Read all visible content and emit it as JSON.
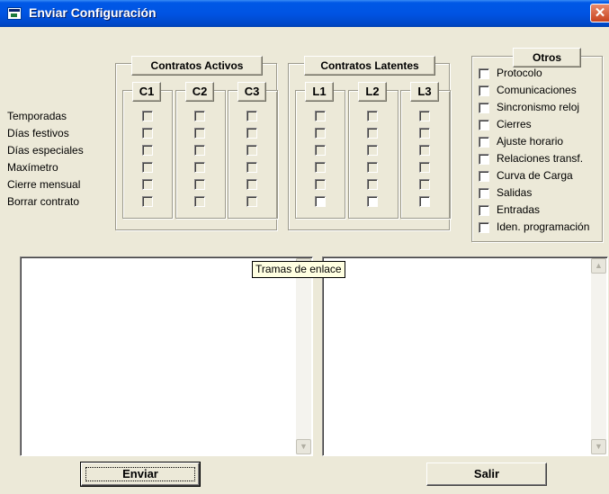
{
  "window": {
    "title": "Enviar Configuración",
    "close_glyph": "✕",
    "icon": "app-window-icon"
  },
  "activos": {
    "title": "Contratos Activos",
    "columns": [
      "C1",
      "C2",
      "C3"
    ]
  },
  "latentes": {
    "title": "Contratos Latentes",
    "columns": [
      "L1",
      "L2",
      "L3"
    ]
  },
  "rows": [
    "Temporadas",
    "Días festivos",
    "Días especiales",
    "Maxímetro",
    "Cierre mensual",
    "Borrar contrato"
  ],
  "otros": {
    "title": "Otros",
    "items": [
      "Protocolo",
      "Comunicaciones",
      "Sincronismo reloj",
      "Cierres",
      "Ajuste horario",
      "Relaciones transf.",
      "Curva de Carga",
      "Salidas",
      "Entradas",
      "Iden. programación"
    ]
  },
  "tooltip": "Tramas de enlace",
  "buttons": {
    "send": "Enviar",
    "exit": "Salir"
  },
  "colors": {
    "titlebar": "#0054e3",
    "dialog": "#ece9d8",
    "close": "#c8431f"
  }
}
